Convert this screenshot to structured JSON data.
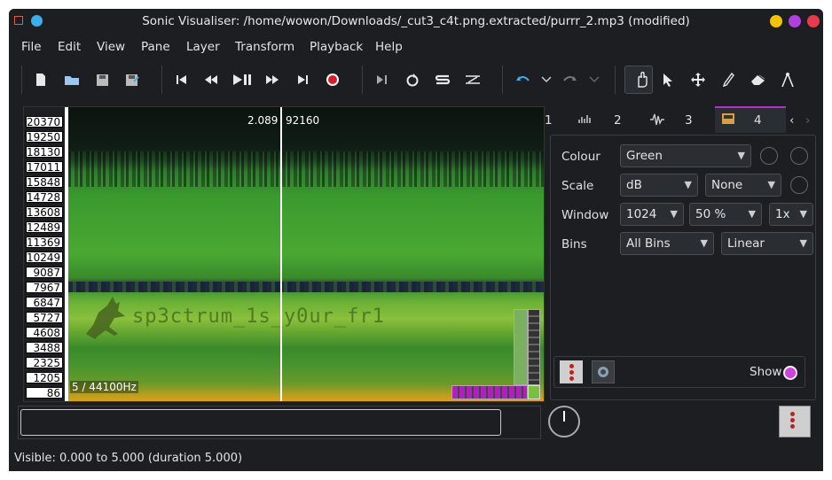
{
  "window": {
    "title": "Sonic Visualiser: /home/wowon/Downloads/_cut3_c4t.png.extracted/purrr_2.mp3 (modified)",
    "controls": {
      "minimize_color": "#f5c400",
      "maximize_color": "#b040e0",
      "close_color": "#e83a4a"
    }
  },
  "menu": [
    "File",
    "Edit",
    "View",
    "Pane",
    "Layer",
    "Transform",
    "Playback",
    "Help"
  ],
  "toolbar": {
    "icons": [
      "new-file-icon",
      "open-folder-icon",
      "save-icon",
      "save-as-icon",
      "rewind-start-icon",
      "rewind-icon",
      "play-pause-icon",
      "fast-forward-icon",
      "forward-end-icon",
      "record-icon",
      "constrain-play-icon",
      "loop-icon",
      "solo-icon",
      "align-icon",
      "undo-icon",
      "undo-menu-icon",
      "redo-icon",
      "redo-menu-icon",
      "navigate-icon",
      "select-icon",
      "move-icon",
      "draw-icon",
      "erase-icon",
      "measure-icon"
    ]
  },
  "spectrogram": {
    "freq_labels": [
      "20370",
      "19250",
      "18130",
      "17011",
      "15848",
      "14728",
      "13608",
      "12489",
      "11369",
      "10249",
      "9087",
      "7967",
      "6847",
      "5727",
      "4608",
      "3488",
      "2325",
      "1205",
      "86"
    ],
    "time_readout": "2.089",
    "frame_readout": "92160",
    "rate_readout": "5 / 44100Hz",
    "embedded_text": "sp3ctrum_1s_y0ur_fr1",
    "colors": {
      "accent": "#b030d0",
      "playhead": "#ffffff"
    }
  },
  "layer_tabs": {
    "labels": [
      "1",
      "2",
      "3",
      "4"
    ],
    "active": "4"
  },
  "properties": {
    "colour": {
      "label": "Colour",
      "value": "Green"
    },
    "scale": {
      "label": "Scale",
      "value": "dB",
      "normalize": "None"
    },
    "window": {
      "label": "Window",
      "size": "1024",
      "overlap": "50 %",
      "oversample": "1x"
    },
    "bins": {
      "label": "Bins",
      "display": "All Bins",
      "frequency_scale": "Linear"
    },
    "show_label": "Show"
  },
  "status": "Visible: 0.000 to 5.000 (duration 5.000)"
}
